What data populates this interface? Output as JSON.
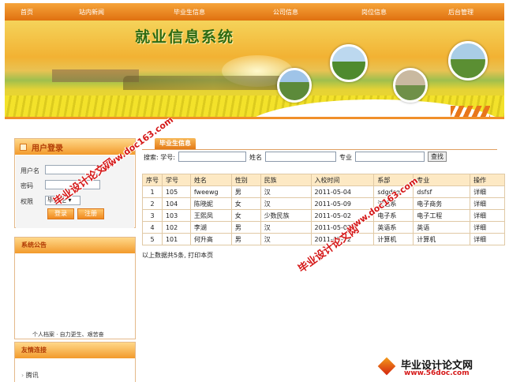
{
  "nav": {
    "items": [
      "首页",
      "站内新闻",
      "毕业生信息",
      "公司信息",
      "岗位信息",
      "后台管理"
    ]
  },
  "banner": {
    "title": "就业信息系统"
  },
  "login": {
    "title": "用户登录",
    "username_label": "用户名",
    "password_label": "密码",
    "role_label": "权限",
    "role_value": "毕业生",
    "login_button": "登录",
    "register_button": "注册"
  },
  "notice": {
    "title": "系统公告",
    "ticker": "个人档案 · 自力更生、艰苦奋"
  },
  "links": {
    "title": "友情连接",
    "items": [
      "腾讯"
    ]
  },
  "main": {
    "tab": "毕业生信息",
    "search": {
      "student_id_label": "搜索: 学号:",
      "name_label": "姓名",
      "major_label": "专业",
      "button": "查找"
    },
    "table": {
      "headers": [
        "序号",
        "学号",
        "姓名",
        "性别",
        "民族",
        "入校时间",
        "系部",
        "专业",
        "操作"
      ],
      "rows": [
        [
          "1",
          "105",
          "fweewg",
          "男",
          "汉",
          "2011-05-04",
          "sdgdsg",
          "dsfsf",
          "详细"
        ],
        [
          "2",
          "104",
          "陈晓妮",
          "女",
          "汉",
          "2011-05-09",
          "汉语系",
          "电子商务",
          "详细"
        ],
        [
          "3",
          "103",
          "王熙凤",
          "女",
          "少数民族",
          "2011-05-02",
          "电子系",
          "电子工程",
          "详细"
        ],
        [
          "4",
          "102",
          "李湖",
          "男",
          "汉",
          "2011-05-02",
          "英语系",
          "英语",
          "详细"
        ],
        [
          "5",
          "101",
          "何升高",
          "男",
          "汉",
          "2011-05-02",
          "计算机",
          "计算机",
          "详细"
        ]
      ]
    },
    "summary": "以上数据共5条, 打印本页"
  },
  "watermark": {
    "text": "毕业设计论文网",
    "url": "www.doc163.com",
    "footer_text": "毕业设计论文网",
    "footer_url": "www.56doc.com"
  },
  "colors": {
    "accent": "#f08f2a",
    "title_green": "#2e6a12",
    "watermark_red": "#d51818"
  }
}
